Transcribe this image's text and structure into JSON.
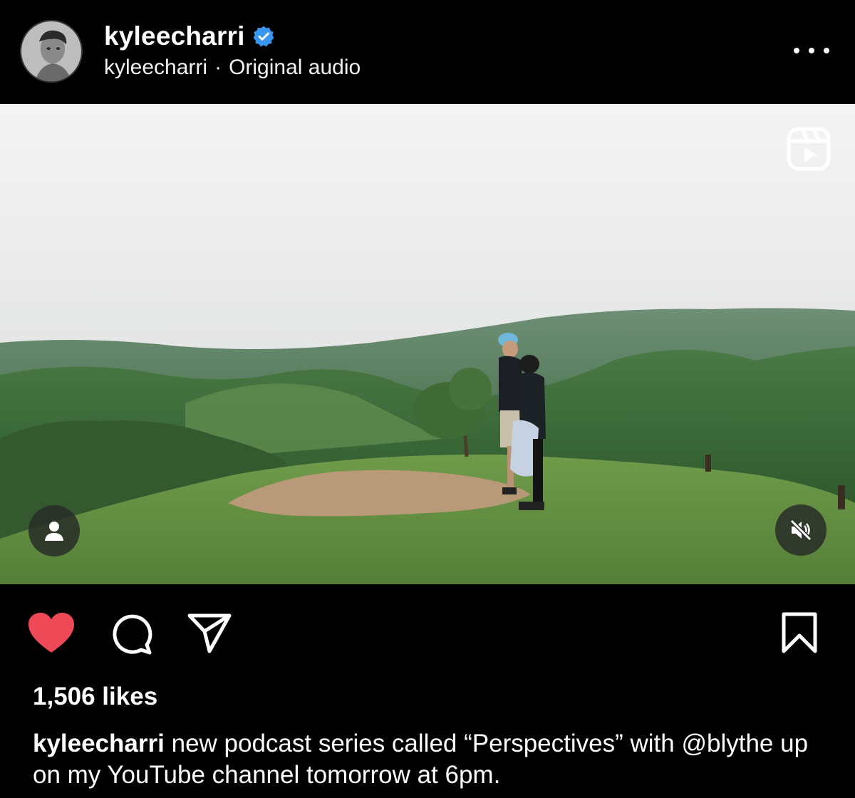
{
  "post": {
    "username": "kyleecharri",
    "verified": true,
    "audio_owner": "kyleecharri",
    "separator": "·",
    "audio_label": "Original audio",
    "media_type_icon": "reels-icon",
    "likes_text": "1,506 likes",
    "liked": true,
    "caption_user": "kyleecharri",
    "caption_text": " new podcast series called “Perspectives” with @blythe up on my YouTube channel tomorrow at 6pm."
  },
  "colors": {
    "background": "#000000",
    "verified_blue": "#3897f0",
    "like_red": "#ed4956"
  },
  "icons": {
    "more": "more-dots-icon",
    "user_tag": "user-tag-icon",
    "mute": "speaker-muted-icon",
    "like": "heart-icon",
    "comment": "comment-bubble-icon",
    "share": "paper-plane-icon",
    "save": "bookmark-icon"
  }
}
